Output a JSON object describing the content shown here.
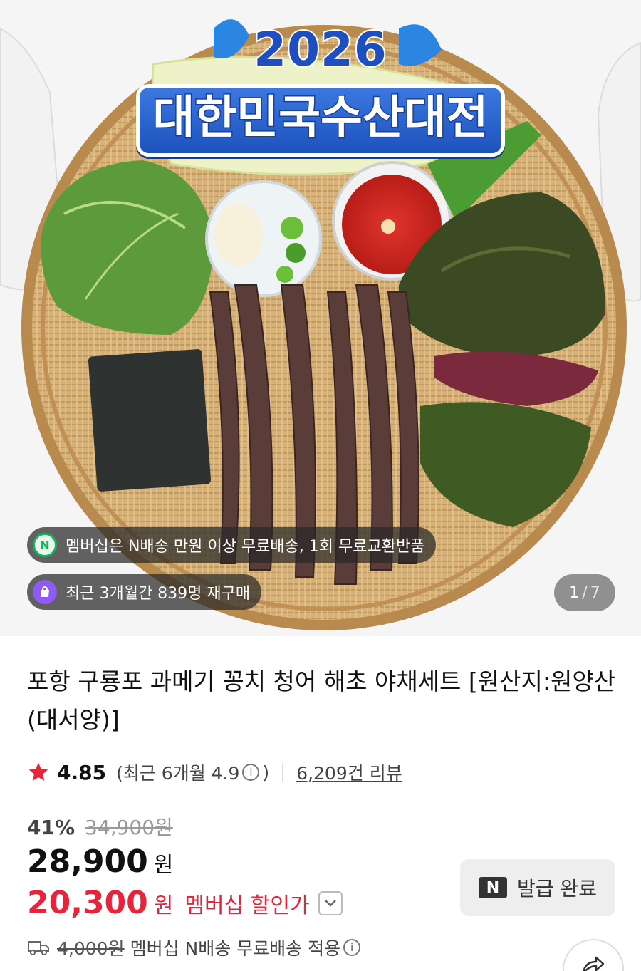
{
  "hero": {
    "banner_year": "2026",
    "banner_title": "대한민국수산대전",
    "pill_membership": "멤버십은 N배송 만원 이상 무료배송, 1회 무료교환반품",
    "pill_membership_badge": "N",
    "pill_repurchase": "최근 3개월간 839명 재구매",
    "counter_current": "1",
    "counter_sep": "/",
    "counter_total": "7"
  },
  "product": {
    "title": "포항 구룡포 과메기 꽁치 청어 해초 야채세트 [원산지:원양산(대서양)]",
    "rating": "4.85",
    "recent_rating_open": "(최근 6개월 4.9",
    "info_glyph": "i",
    "recent_rating_close": ")",
    "review_count": "6,209건 리뷰",
    "discount_percent": "41%",
    "original_price": "34,900원",
    "price": "28,900",
    "price_unit": "원",
    "member_price": "20,300",
    "member_unit": "원",
    "member_label": "멤버십 할인가",
    "coupon_icon": "N",
    "coupon_label": "발급 완료",
    "shipping_old": "4,000원",
    "shipping_text": "멤버십 N배송 무료배송 적용"
  },
  "colors": {
    "accent_red": "#e8243b",
    "membership_green": "#13b556",
    "repurchase_purple": "#8e5bf5",
    "star": "#e8243b"
  },
  "icons": [
    "star-icon",
    "info-icon",
    "chevron-down-icon",
    "truck-icon",
    "share-icon",
    "n-delivery-icon",
    "shopping-bag-icon"
  ]
}
